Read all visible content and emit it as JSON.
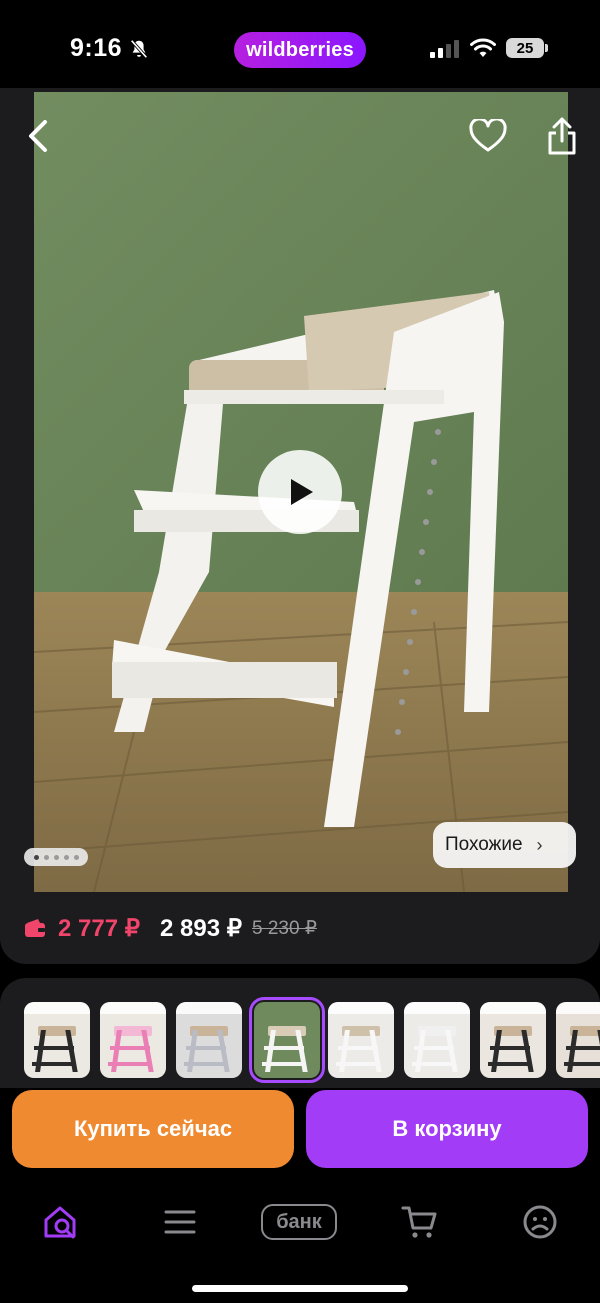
{
  "status_bar": {
    "time": "9:16",
    "brand": "wildberries",
    "battery": "25",
    "icons": [
      "bell-slash-icon",
      "signal-icon",
      "wifi-icon",
      "battery-icon"
    ]
  },
  "product": {
    "media": {
      "icons": [
        "back-arrow-icon",
        "heart-icon",
        "share-icon",
        "play-icon"
      ],
      "slide_count": 5,
      "active_slide": 1,
      "similar_label": "Похожие",
      "similar_chevron": "›"
    },
    "prices": {
      "wallet_price": "2 777 ₽",
      "price": "2 893 ₽",
      "old_price": "5 230 ₽"
    }
  },
  "thumbnails": {
    "selected_index": 3,
    "items": [
      {
        "bg": "#ece8e2",
        "chair": "#2a2a2a",
        "seat": "#c9b49a"
      },
      {
        "bg": "#ece8e2",
        "chair": "#e97fb5",
        "seat": "#f2b8d4"
      },
      {
        "bg": "#dcdcdc",
        "chair": "#b9bcc4",
        "seat": "#c9b49a"
      },
      {
        "bg": "#6f8a5c",
        "chair": "#f5f5f5",
        "seat": "#d8ccb6"
      },
      {
        "bg": "#ecebe8",
        "chair": "#f7f7f7",
        "seat": "#cfc1a9"
      },
      {
        "bg": "#ecebe8",
        "chair": "#f7f7f7",
        "seat": "#f0f0f0"
      },
      {
        "bg": "#ebe6df",
        "chair": "#2b2b2b",
        "seat": "#c9b49a"
      },
      {
        "bg": "#e6e0d8",
        "chair": "#2b2b2b",
        "seat": "#c9b49a"
      }
    ]
  },
  "actions": {
    "buy_now": "Купить сейчас",
    "add_to_cart": "В корзину"
  },
  "bottom_nav": {
    "bank_label": "банк",
    "icons": [
      "home-search-icon",
      "catalog-menu-icon",
      "cart-icon",
      "profile-icon"
    ],
    "active_color": "#a33cf6",
    "inactive_color": "#8a8a8e"
  },
  "colors": {
    "accent_purple": "#a33cf6",
    "accent_orange": "#f08a30",
    "wallet_price": "#f1456b",
    "surface": "#1c1c1e"
  }
}
